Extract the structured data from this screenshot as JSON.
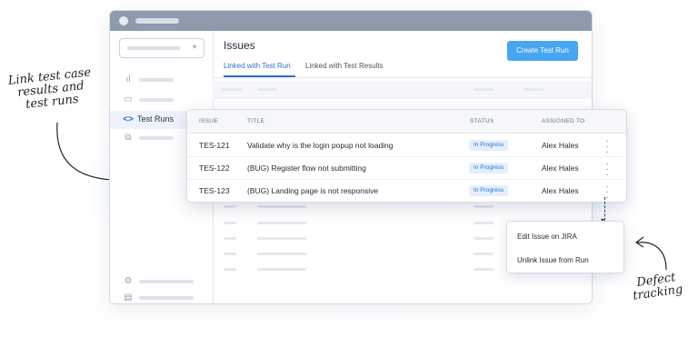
{
  "annotations": {
    "left_note": [
      "Link test case",
      "results and",
      "test runs"
    ],
    "right_note": [
      "Defect",
      "tracking"
    ]
  },
  "sidebar": {
    "active_item": {
      "icon": "code-icon",
      "label": "Test Runs"
    }
  },
  "main": {
    "title": "Issues",
    "tabs": [
      {
        "label": "Linked with Test Run",
        "active": true
      },
      {
        "label": "Linked with Test Results",
        "active": false
      }
    ],
    "create_button": "Create Test Run"
  },
  "issues_table": {
    "headers": [
      "ISSUE",
      "TITLE",
      "STATUS",
      "ASSIGNED TO"
    ],
    "rows": [
      {
        "issue": "TES-121",
        "title": "Validate why is the login popup not loading",
        "status": "In Progress",
        "assignee": "Alex Hales"
      },
      {
        "issue": "TES-122",
        "title": "(BUG) Register flow not submitting",
        "status": "In Progress",
        "assignee": "Alex Hales"
      },
      {
        "issue": "TES-123",
        "title": "(BUG) Landing page is not responsive",
        "status": "In Progress",
        "assignee": "Alex Hales"
      }
    ]
  },
  "row_menu": {
    "items": [
      "Edit Issue on JIRA",
      "Unlink Issue from Run"
    ]
  },
  "colors": {
    "accent": "#2f6fd3",
    "button": "#46a6f2",
    "titlebar": "#8e9aad",
    "badge_bg": "#e3effd"
  }
}
